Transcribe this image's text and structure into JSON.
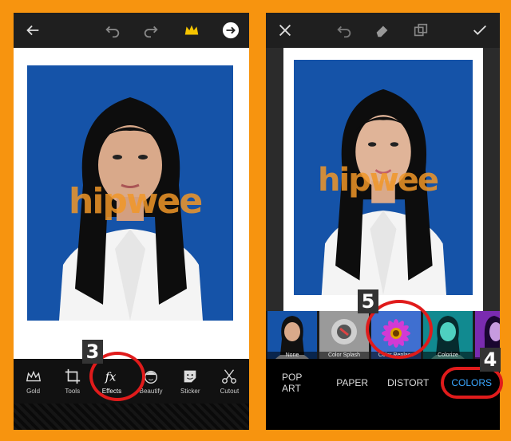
{
  "left": {
    "tools": [
      {
        "label": "Gold",
        "icon": "crown-icon"
      },
      {
        "label": "Tools",
        "icon": "crop-icon"
      },
      {
        "label": "Effects",
        "icon": "fx-icon"
      },
      {
        "label": "Beautify",
        "icon": "face-icon"
      },
      {
        "label": "Sticker",
        "icon": "sticker-icon"
      },
      {
        "label": "Cutout",
        "icon": "scissors-icon"
      }
    ],
    "step_number": "3"
  },
  "right": {
    "effects": [
      {
        "label": "None"
      },
      {
        "label": "Color Splash"
      },
      {
        "label": "Color Replace"
      },
      {
        "label": "Colorize"
      },
      {
        "label": ""
      }
    ],
    "categories": [
      "POP ART",
      "PAPER",
      "DISTORT",
      "COLORS"
    ],
    "active_category": "COLORS",
    "step_effect": "5",
    "step_category": "4"
  },
  "watermark": "hipwee",
  "colors": {
    "background": "#f7940f",
    "accent": "#3aa7ff",
    "highlight": "#e01b1b",
    "photo_bg": "#1553a8"
  }
}
